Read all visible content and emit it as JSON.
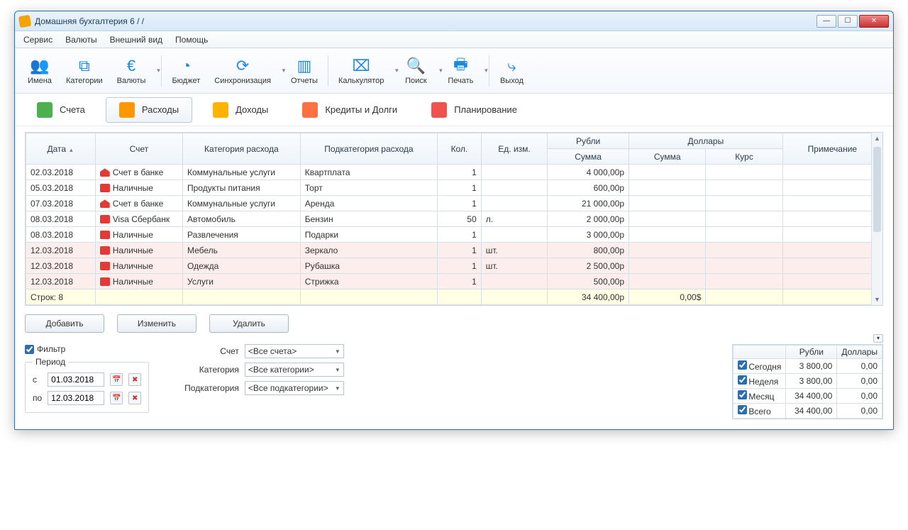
{
  "window": {
    "title": "Домашняя бухгалтерия 6 /               /"
  },
  "menubar": [
    "Сервис",
    "Валюты",
    "Внешний вид",
    "Помощь"
  ],
  "toolbar": [
    {
      "id": "names",
      "label": "Имена",
      "glyph": "👥"
    },
    {
      "id": "categories",
      "label": "Категории",
      "glyph": "⧉"
    },
    {
      "id": "currencies",
      "label": "Валюты",
      "glyph": "€",
      "drop": true
    },
    {
      "sep": true
    },
    {
      "id": "budget",
      "label": "Бюджет",
      "glyph": "◔"
    },
    {
      "id": "sync",
      "label": "Синхронизация",
      "glyph": "⟳",
      "drop": true
    },
    {
      "id": "reports",
      "label": "Отчеты",
      "glyph": "▥"
    },
    {
      "sep": true
    },
    {
      "id": "calc",
      "label": "Калькулятор",
      "glyph": "⌧",
      "drop": true
    },
    {
      "id": "search",
      "label": "Поиск",
      "glyph": "🔍",
      "drop": true
    },
    {
      "id": "print",
      "label": "Печать",
      "glyph": "🖶",
      "drop": true
    },
    {
      "sep": true
    },
    {
      "id": "exit",
      "label": "Выход",
      "glyph": "⤷"
    }
  ],
  "tabs": [
    {
      "id": "accounts",
      "label": "Счета",
      "color": "#4caf50"
    },
    {
      "id": "expenses",
      "label": "Расходы",
      "color": "#ff9800",
      "active": true
    },
    {
      "id": "income",
      "label": "Доходы",
      "color": "#ffb300"
    },
    {
      "id": "credits",
      "label": "Кредиты и Долги",
      "color": "#ff7043"
    },
    {
      "id": "planning",
      "label": "Планирование",
      "color": "#ef5350"
    }
  ],
  "grid": {
    "headers": {
      "date": "Дата",
      "account": "Счет",
      "category": "Категория расхода",
      "subcategory": "Подкатегория расхода",
      "qty": "Кол.",
      "unit": "Ед. изм.",
      "rub": "Рубли",
      "rub_sum": "Сумма",
      "usd": "Доллары",
      "usd_sum": "Сумма",
      "rate": "Курс",
      "note": "Примечание"
    },
    "rows": [
      {
        "date": "02.03.2018",
        "act": "Счет в банке",
        "ico": "bank",
        "cat": "Коммунальные услуги",
        "sub": "Квартплата",
        "qty": "1",
        "unit": "",
        "sum": "4 000,00р"
      },
      {
        "date": "05.03.2018",
        "act": "Наличные",
        "ico": "cash",
        "cat": "Продукты питания",
        "sub": "Торт",
        "qty": "1",
        "unit": "",
        "sum": "600,00р"
      },
      {
        "date": "07.03.2018",
        "act": "Счет в банке",
        "ico": "bank",
        "cat": "Коммунальные услуги",
        "sub": "Аренда",
        "qty": "1",
        "unit": "",
        "sum": "21 000,00р"
      },
      {
        "date": "08.03.2018",
        "act": "Visa Сбербанк",
        "ico": "visa",
        "cat": "Автомобиль",
        "sub": "Бензин",
        "qty": "50",
        "unit": "л.",
        "sum": "2 000,00р"
      },
      {
        "date": "08.03.2018",
        "act": "Наличные",
        "ico": "cash",
        "cat": "Развлечения",
        "sub": "Подарки",
        "qty": "1",
        "unit": "",
        "sum": "3 000,00р"
      },
      {
        "date": "12.03.2018",
        "act": "Наличные",
        "ico": "cash",
        "cat": "Мебель",
        "sub": "Зеркало",
        "qty": "1",
        "unit": "шт.",
        "sum": "800,00р",
        "hl": true
      },
      {
        "date": "12.03.2018",
        "act": "Наличные",
        "ico": "cash",
        "cat": "Одежда",
        "sub": "Рубашка",
        "qty": "1",
        "unit": "шт.",
        "sum": "2 500,00р",
        "hl": true
      },
      {
        "date": "12.03.2018",
        "act": "Наличные",
        "ico": "cash",
        "cat": "Услуги",
        "sub": "Стрижка",
        "qty": "1",
        "unit": "",
        "sum": "500,00р",
        "hl": true
      }
    ],
    "summary": {
      "label": "Строк: 8",
      "rub": "34 400,00р",
      "usd": "0,00$"
    }
  },
  "actions": {
    "add": "Добавить",
    "edit": "Изменить",
    "delete": "Удалить"
  },
  "filter": {
    "checkbox": "Фильтр",
    "period_legend": "Период",
    "from": "с",
    "to": "по",
    "from_date": "01.03.2018",
    "to_date": "12.03.2018",
    "account_lbl": "Счет",
    "account_val": "<Все счета>",
    "category_lbl": "Категория",
    "category_val": "<Все категории>",
    "subcategory_lbl": "Подкатегория",
    "subcategory_val": "<Все подкатегории>"
  },
  "totals": {
    "headers": {
      "rub": "Рубли",
      "usd": "Доллары"
    },
    "rows": [
      {
        "lbl": "Сегодня",
        "rub": "3 800,00",
        "usd": "0,00"
      },
      {
        "lbl": "Неделя",
        "rub": "3 800,00",
        "usd": "0,00"
      },
      {
        "lbl": "Месяц",
        "rub": "34 400,00",
        "usd": "0,00"
      },
      {
        "lbl": "Всего",
        "rub": "34 400,00",
        "usd": "0,00"
      }
    ]
  }
}
